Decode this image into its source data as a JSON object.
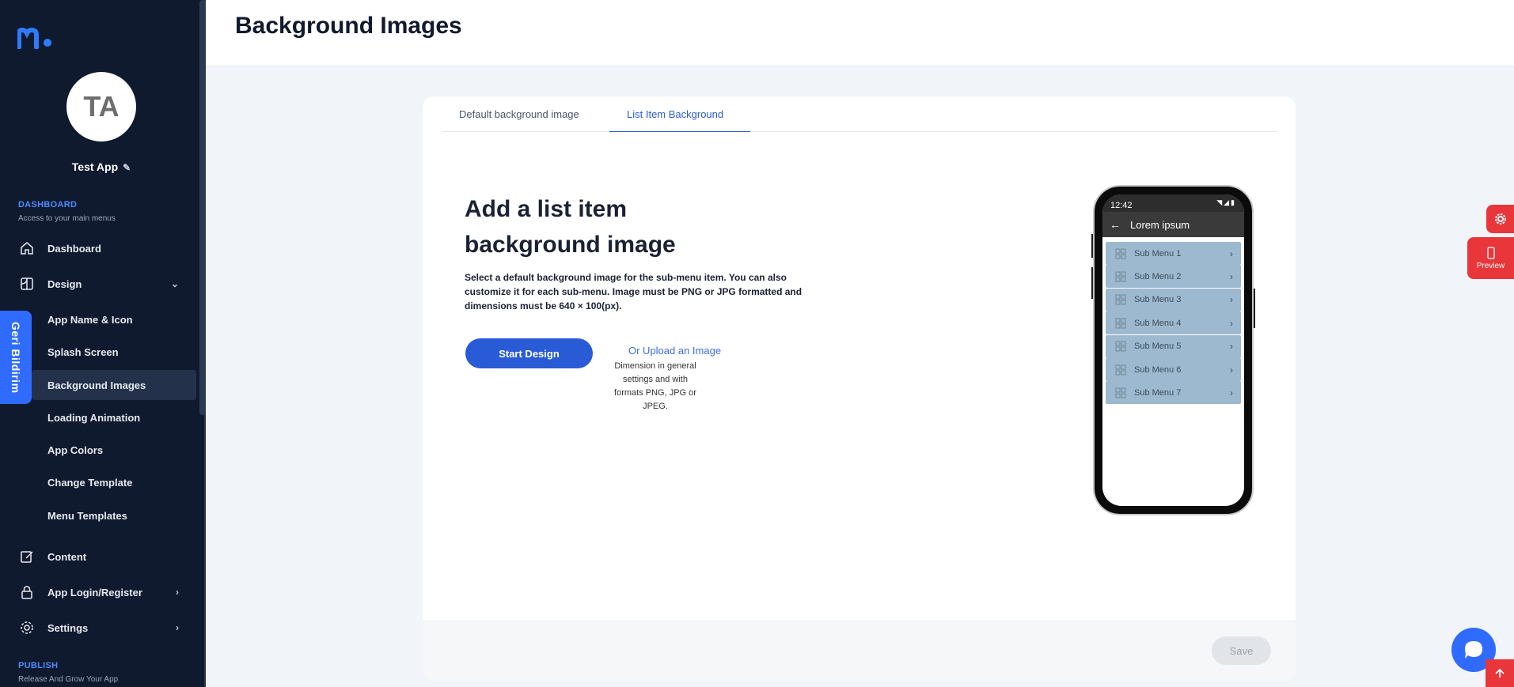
{
  "sidebar": {
    "avatar_initials": "TA",
    "app_name": "Test App",
    "dashboard_section": {
      "title": "DASHBOARD",
      "subtitle": "Access to your main menus"
    },
    "publish_section": {
      "title": "PUBLISH",
      "subtitle": "Release And Grow Your App"
    },
    "items": {
      "dashboard": "Dashboard",
      "design": "Design",
      "content": "Content",
      "app_login": "App Login/Register",
      "settings": "Settings"
    },
    "design_sub": [
      {
        "label": "App Name & Icon"
      },
      {
        "label": "Splash Screen"
      },
      {
        "label": "Background Images",
        "active": true
      },
      {
        "label": "Loading Animation"
      },
      {
        "label": "App Colors"
      },
      {
        "label": "Change Template"
      },
      {
        "label": "Menu Templates"
      }
    ],
    "feedback_label": "Geri Bildirim"
  },
  "header": {
    "title": "Background Images"
  },
  "tabs": [
    {
      "label": "Default background image",
      "active": false
    },
    {
      "label": "List Item Background",
      "active": true
    }
  ],
  "main": {
    "heading": "Add a list item background image",
    "description": "Select a default background image for the sub-menu item. You can also customize it for each sub-menu. Image must be PNG or JPG formatted and dimensions must be 640 × 100(px).",
    "start_button": "Start Design",
    "upload_link": "Or Upload an Image",
    "upload_note": "Dimension in general settings and with formats PNG, JPG or JPEG.",
    "save_button": "Save"
  },
  "phone": {
    "time": "12:42",
    "title": "Lorem ipsum",
    "menu_items": [
      "Sub Menu 1",
      "Sub Menu 2",
      "Sub Menu 3",
      "Sub Menu 4",
      "Sub Menu 5",
      "Sub Menu 6",
      "Sub Menu 7"
    ],
    "row_color": "#9db9cf"
  },
  "floating": {
    "preview_label": "Preview"
  },
  "colors": {
    "accent": "#2a5bd7",
    "sidebar_bg": "#0f1a2e",
    "danger": "#e8363a"
  }
}
